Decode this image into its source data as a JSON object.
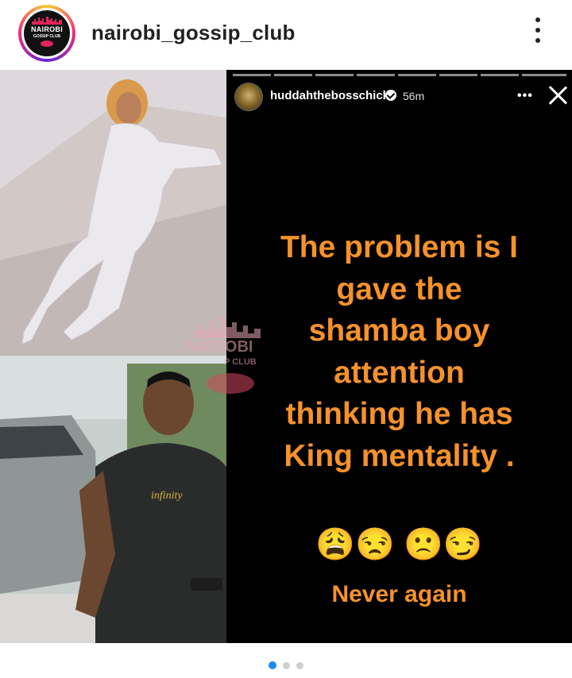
{
  "header": {
    "username": "nairobi_gossip_club",
    "avatar_title": "NAIROBI",
    "avatar_subtitle": "GOSSIP CLUB",
    "more_icon": "more-vertical-icon"
  },
  "collage": {
    "watermark_title": "NAIROBI",
    "watermark_subtitle": "P CLUB"
  },
  "story": {
    "username": "huddahthebosschick",
    "time": "56m",
    "verified_icon": "verified-badge-icon",
    "more_label": "•••",
    "close_icon": "close-icon",
    "text_lines": [
      "The problem is I",
      "gave the",
      "shamba boy",
      "attention",
      "thinking he has",
      "King mentality ."
    ],
    "emojis": "😩😒 🙁😏",
    "footer_text": "Never again",
    "text_color": "#f5922a"
  },
  "carousel": {
    "count": 3,
    "active_index": 0,
    "active_color": "#1d8cf0"
  }
}
